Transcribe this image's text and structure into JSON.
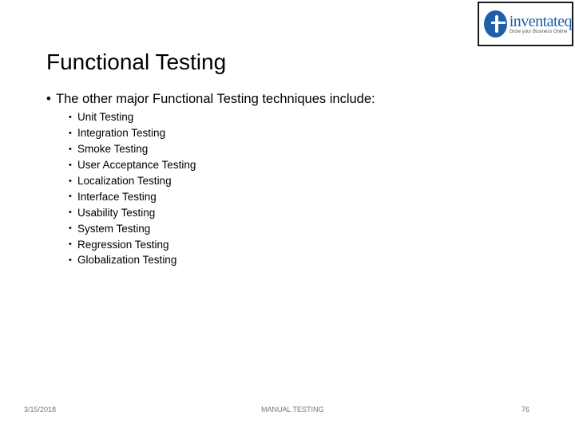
{
  "logo": {
    "brand": "inventateq",
    "tagline": "Grow your Business Online"
  },
  "slide": {
    "title": "Functional Testing",
    "intro": "The other major Functional Testing techniques include:",
    "bullet_glyph": "•",
    "items": [
      "Unit Testing",
      "Integration Testing",
      "Smoke Testing",
      "User Acceptance Testing",
      "Localization Testing",
      "Interface Testing",
      "Usability Testing",
      "System Testing",
      "Regression Testing",
      "Globalization Testing"
    ]
  },
  "footer": {
    "date": "3/15/2018",
    "center": "MANUAL TESTING",
    "page": "76"
  }
}
